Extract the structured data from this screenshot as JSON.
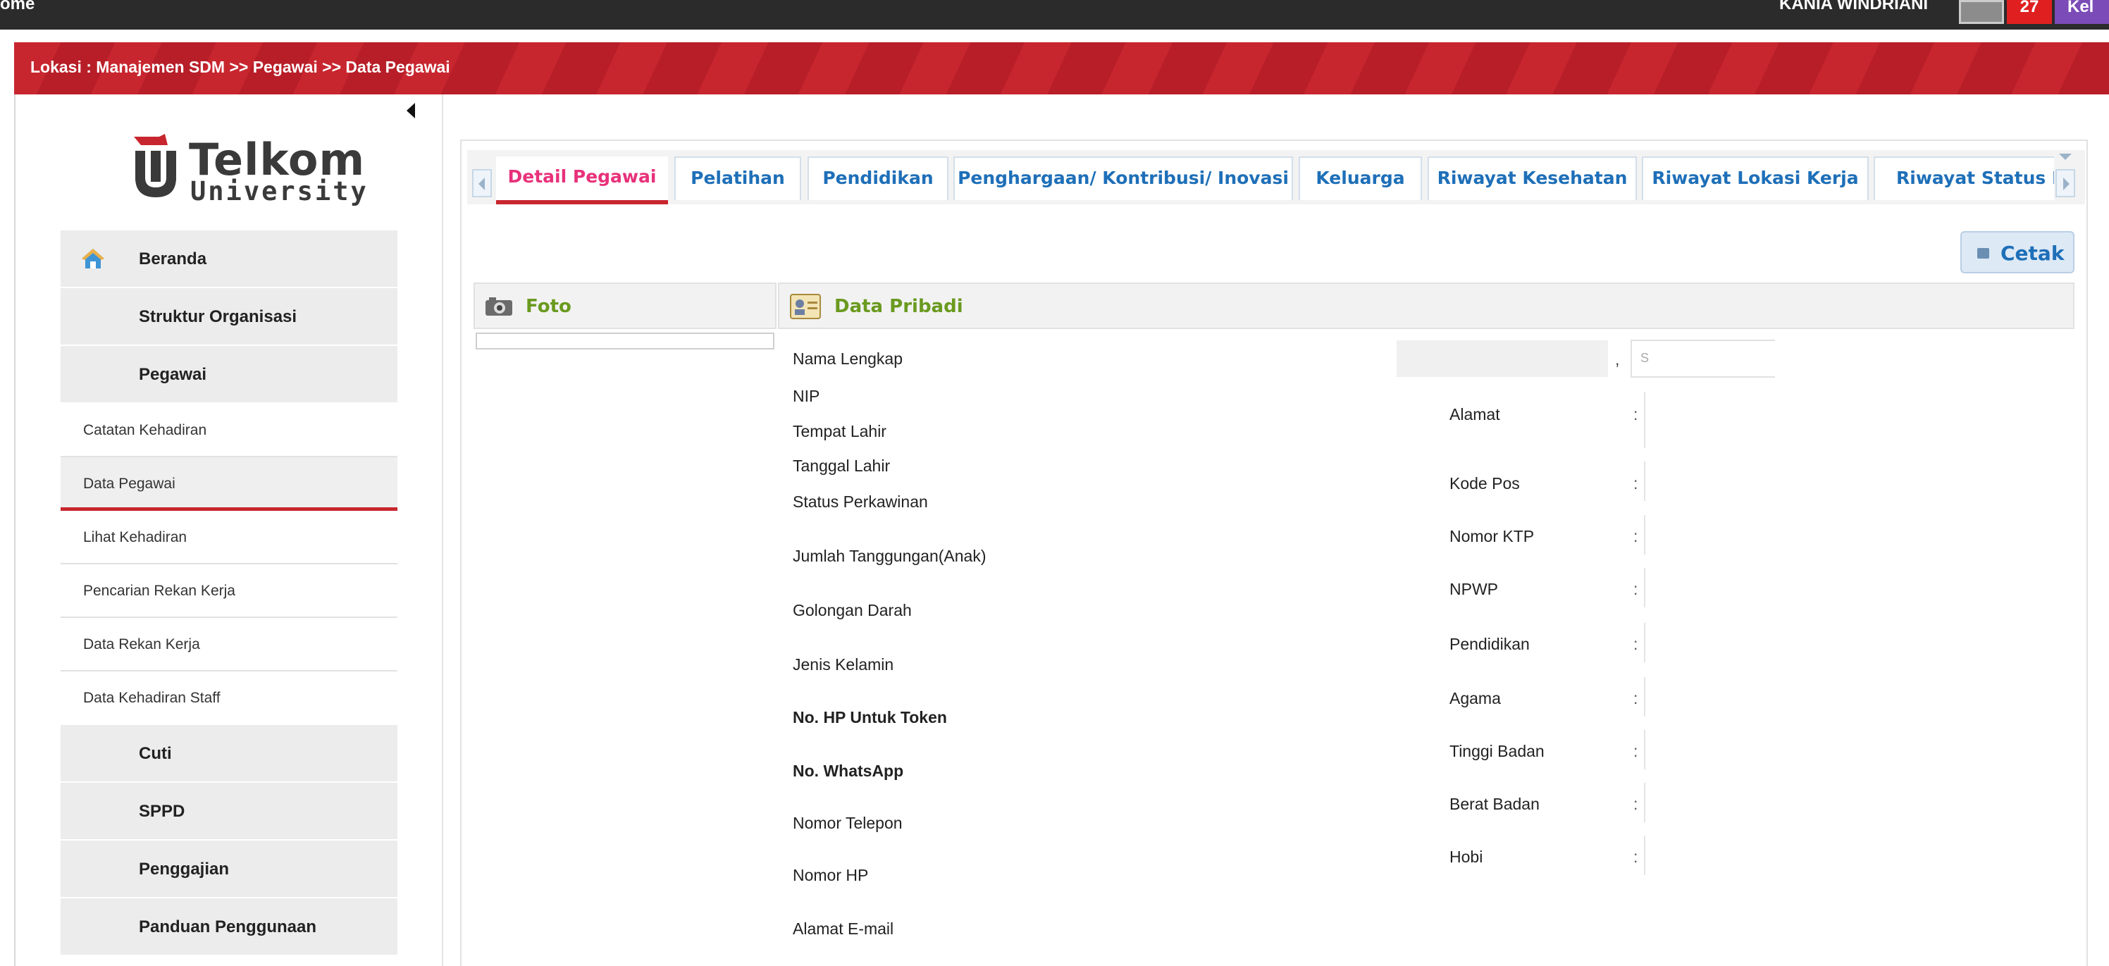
{
  "topbar": {
    "home_label": "ome",
    "user_name": "KANIA WINDRIANI",
    "notif_count": "27",
    "user_menu_label": "Kel"
  },
  "breadcrumb": "Lokasi : Manajemen SDM >> Pegawai >> Data Pegawai",
  "logo": {
    "word1": "Telkom",
    "word2": "University"
  },
  "sidebar": {
    "main_top": [
      {
        "label": "Beranda",
        "icon": "home-icon"
      },
      {
        "label": "Struktur Organisasi"
      },
      {
        "label": "Pegawai"
      }
    ],
    "sub_items": [
      {
        "label": "Catatan Kehadiran"
      },
      {
        "label": "Data Pegawai",
        "active": true
      },
      {
        "label": "Lihat Kehadiran"
      },
      {
        "label": "Pencarian Rekan Kerja"
      },
      {
        "label": "Data Rekan Kerja"
      },
      {
        "label": "Data Kehadiran Staff"
      }
    ],
    "main_bottom": [
      {
        "label": "Cuti"
      },
      {
        "label": "SPPD"
      },
      {
        "label": "Penggajian"
      },
      {
        "label": "Panduan Penggunaan"
      }
    ]
  },
  "tabs": [
    {
      "label": "Detail Pegawai",
      "active": true
    },
    {
      "label": "Pelatihan"
    },
    {
      "label": "Pendidikan"
    },
    {
      "label": "Penghargaan/ Kontribusi/ Inovasi"
    },
    {
      "label": "Keluarga"
    },
    {
      "label": "Riwayat Kesehatan"
    },
    {
      "label": "Riwayat Lokasi Kerja"
    },
    {
      "label": "Riwayat Status Pegawai"
    }
  ],
  "print_button": "Cetak",
  "sections": {
    "photo": "Foto",
    "personal": "Data Pribadi"
  },
  "form_left": [
    {
      "label": "Nama Lengkap"
    },
    {
      "label": "NIP"
    },
    {
      "label": "Tempat Lahir"
    },
    {
      "label": "Tanggal Lahir"
    },
    {
      "label": "Status Perkawinan"
    },
    {
      "label": "Jumlah Tanggungan(Anak)"
    },
    {
      "label": "Golongan Darah"
    },
    {
      "label": "Jenis Kelamin"
    },
    {
      "label": "No. HP Untuk Token",
      "bold": true
    },
    {
      "label": "No. WhatsApp",
      "bold": true
    },
    {
      "label": "Nomor Telepon"
    },
    {
      "label": "Nomor HP"
    },
    {
      "label": "Alamat E-mail"
    }
  ],
  "form_right": [
    {
      "label": "Alamat"
    },
    {
      "label": "Kode Pos"
    },
    {
      "label": "Nomor KTP"
    },
    {
      "label": "NPWP"
    },
    {
      "label": "Pendidikan"
    },
    {
      "label": "Agama"
    },
    {
      "label": "Tinggi Badan"
    },
    {
      "label": "Berat Badan"
    },
    {
      "label": "Hobi"
    }
  ],
  "colon": ":",
  "comma": ",",
  "name_input_placeholder": "S",
  "colors": {
    "brand_red": "#c8262f",
    "link_blue": "#1e6fb8",
    "active_tab_pink": "#e8317a",
    "section_green": "#6a9a1f"
  }
}
